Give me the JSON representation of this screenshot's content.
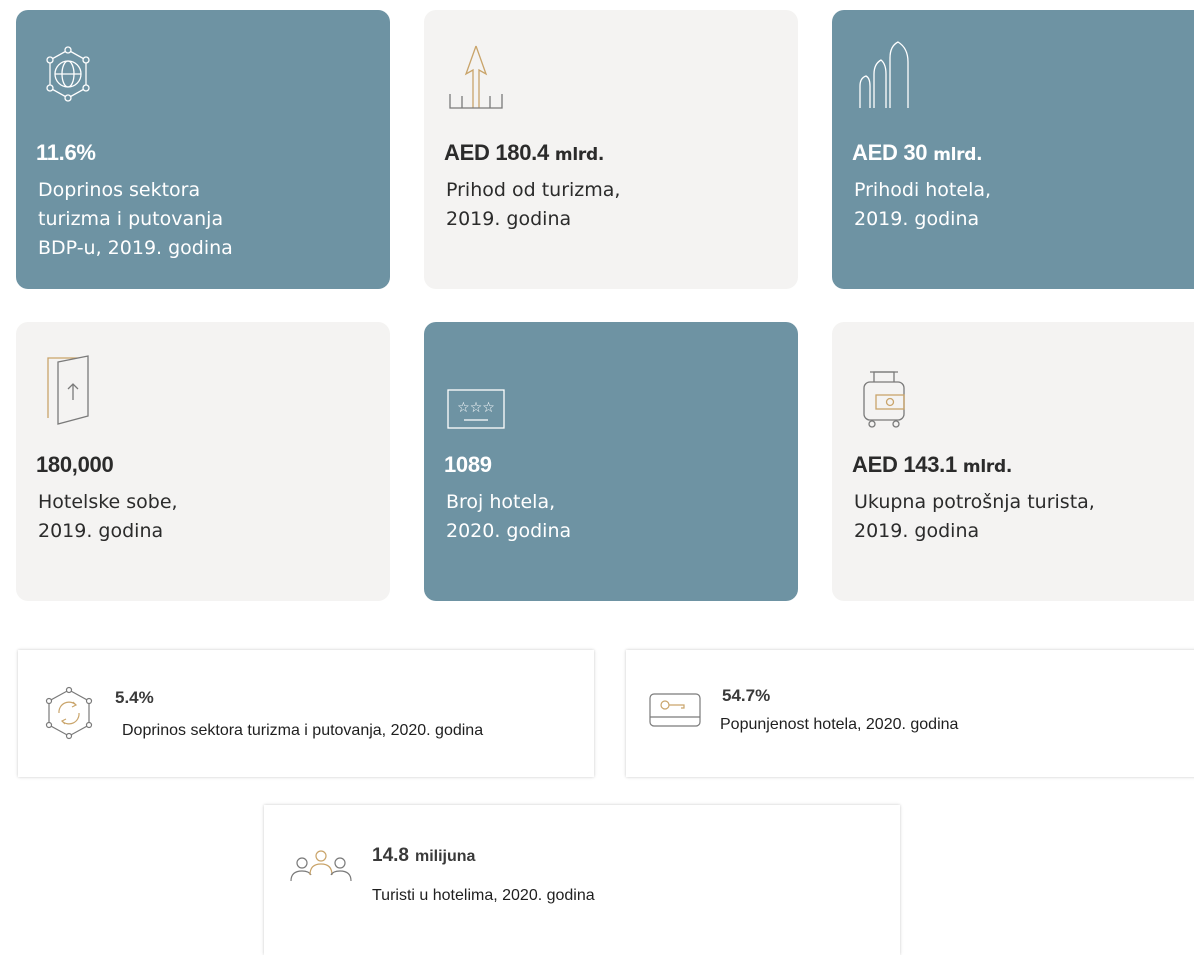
{
  "colors": {
    "teal": "#6e93a3",
    "light": "#f4f3f2",
    "gold": "#c9a46a"
  },
  "cards": [
    {
      "icon": "globe-network-icon",
      "value": "11.6%",
      "unit": "",
      "desc": "Doprinos sektora\nturizma i putovanja\nBDP-u, 2019. godina"
    },
    {
      "icon": "arrow-up-growth-icon",
      "value": "AED 180.4",
      "unit": "mlrd.",
      "desc": "Prihod od turizma,\n2019. godina"
    },
    {
      "icon": "hotel-towers-icon",
      "value": "AED 30",
      "unit": "mlrd.",
      "desc": "Prihodi hotela,\n2019. godina"
    },
    {
      "icon": "hotel-door-icon",
      "value": "180,000",
      "unit": "",
      "desc": "Hotelske sobe,\n2019. godina"
    },
    {
      "icon": "hotel-stars-sign-icon",
      "value": "1089",
      "unit": "",
      "desc": "Broj hotela,\n2020. godina"
    },
    {
      "icon": "luggage-money-icon",
      "value": "AED 143.1",
      "unit": "mlrd.",
      "desc": "Ukupna potrošnja turista,\n2019. godina"
    }
  ],
  "strips": [
    {
      "icon": "cycle-network-icon",
      "value": "5.4%",
      "unit": "",
      "desc": "Doprinos sektora turizma i putovanja, 2020. godina"
    },
    {
      "icon": "key-card-icon",
      "value": "54.7%",
      "unit": "",
      "desc": "Popunjenost hotela, 2020. godina"
    },
    {
      "icon": "people-group-icon",
      "value": "14.8",
      "unit": "milijuna",
      "desc": "Turisti u hotelima, 2020. godina"
    }
  ]
}
